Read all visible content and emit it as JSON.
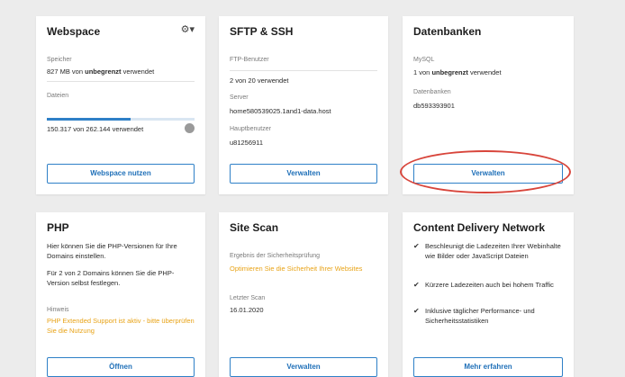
{
  "webspace": {
    "title": "Webspace",
    "gear_icon": "⚙▾",
    "storage_label": "Speicher",
    "storage_pre": "827 MB von ",
    "storage_bold": "unbegrenzt",
    "storage_post": " verwendet",
    "files_label": "Dateien",
    "files_progress": 0.57,
    "files_value": "150.317 von 262.144 verwendet",
    "button": "Webspace nutzen"
  },
  "sftp": {
    "title": "SFTP & SSH",
    "ftp_users_label": "FTP-Benutzer",
    "ftp_users_value": "2 von 20 verwendet",
    "server_label": "Server",
    "server_value": "home580539025.1and1-data.host",
    "main_user_label": "Hauptbenutzer",
    "main_user_value": "u81256911",
    "button": "Verwalten"
  },
  "databases": {
    "title": "Datenbanken",
    "mysql_label": "MySQL",
    "mysql_pre": "1 von ",
    "mysql_bold": "unbegrenzt",
    "mysql_post": " verwendet",
    "db_label": "Datenbanken",
    "db_value": "db593393901",
    "button": "Verwalten"
  },
  "php": {
    "title": "PHP",
    "text1": "Hier können Sie die PHP-Versionen für Ihre Domains einstellen.",
    "text2": "Für 2 von 2 Domains können Sie die PHP-Version selbst festlegen.",
    "hint_label": "Hinweis",
    "hint_text": "PHP Extended Support ist aktiv - bitte überprüfen Sie die Nutzung",
    "button": "Öffnen"
  },
  "sitescan": {
    "title": "Site Scan",
    "result_label": "Ergebnis der Sicherheitsprüfung",
    "result_link": "Optimieren Sie die Sicherheit Ihrer Websites",
    "last_scan_label": "Letzter Scan",
    "last_scan_value": "16.01.2020",
    "button": "Verwalten"
  },
  "cdn": {
    "title": "Content Delivery Network",
    "items": [
      "Beschleunigt die Ladezeiten Ihrer Webinhalte wie Bilder oder JavaScript Dateien",
      "Kürzere Ladezeiten auch bei hohem Traffic",
      "Inklusive täglicher Performance- und Sicherheitsstatistiken"
    ],
    "check_icon": "✔",
    "button": "Mehr erfahren"
  }
}
